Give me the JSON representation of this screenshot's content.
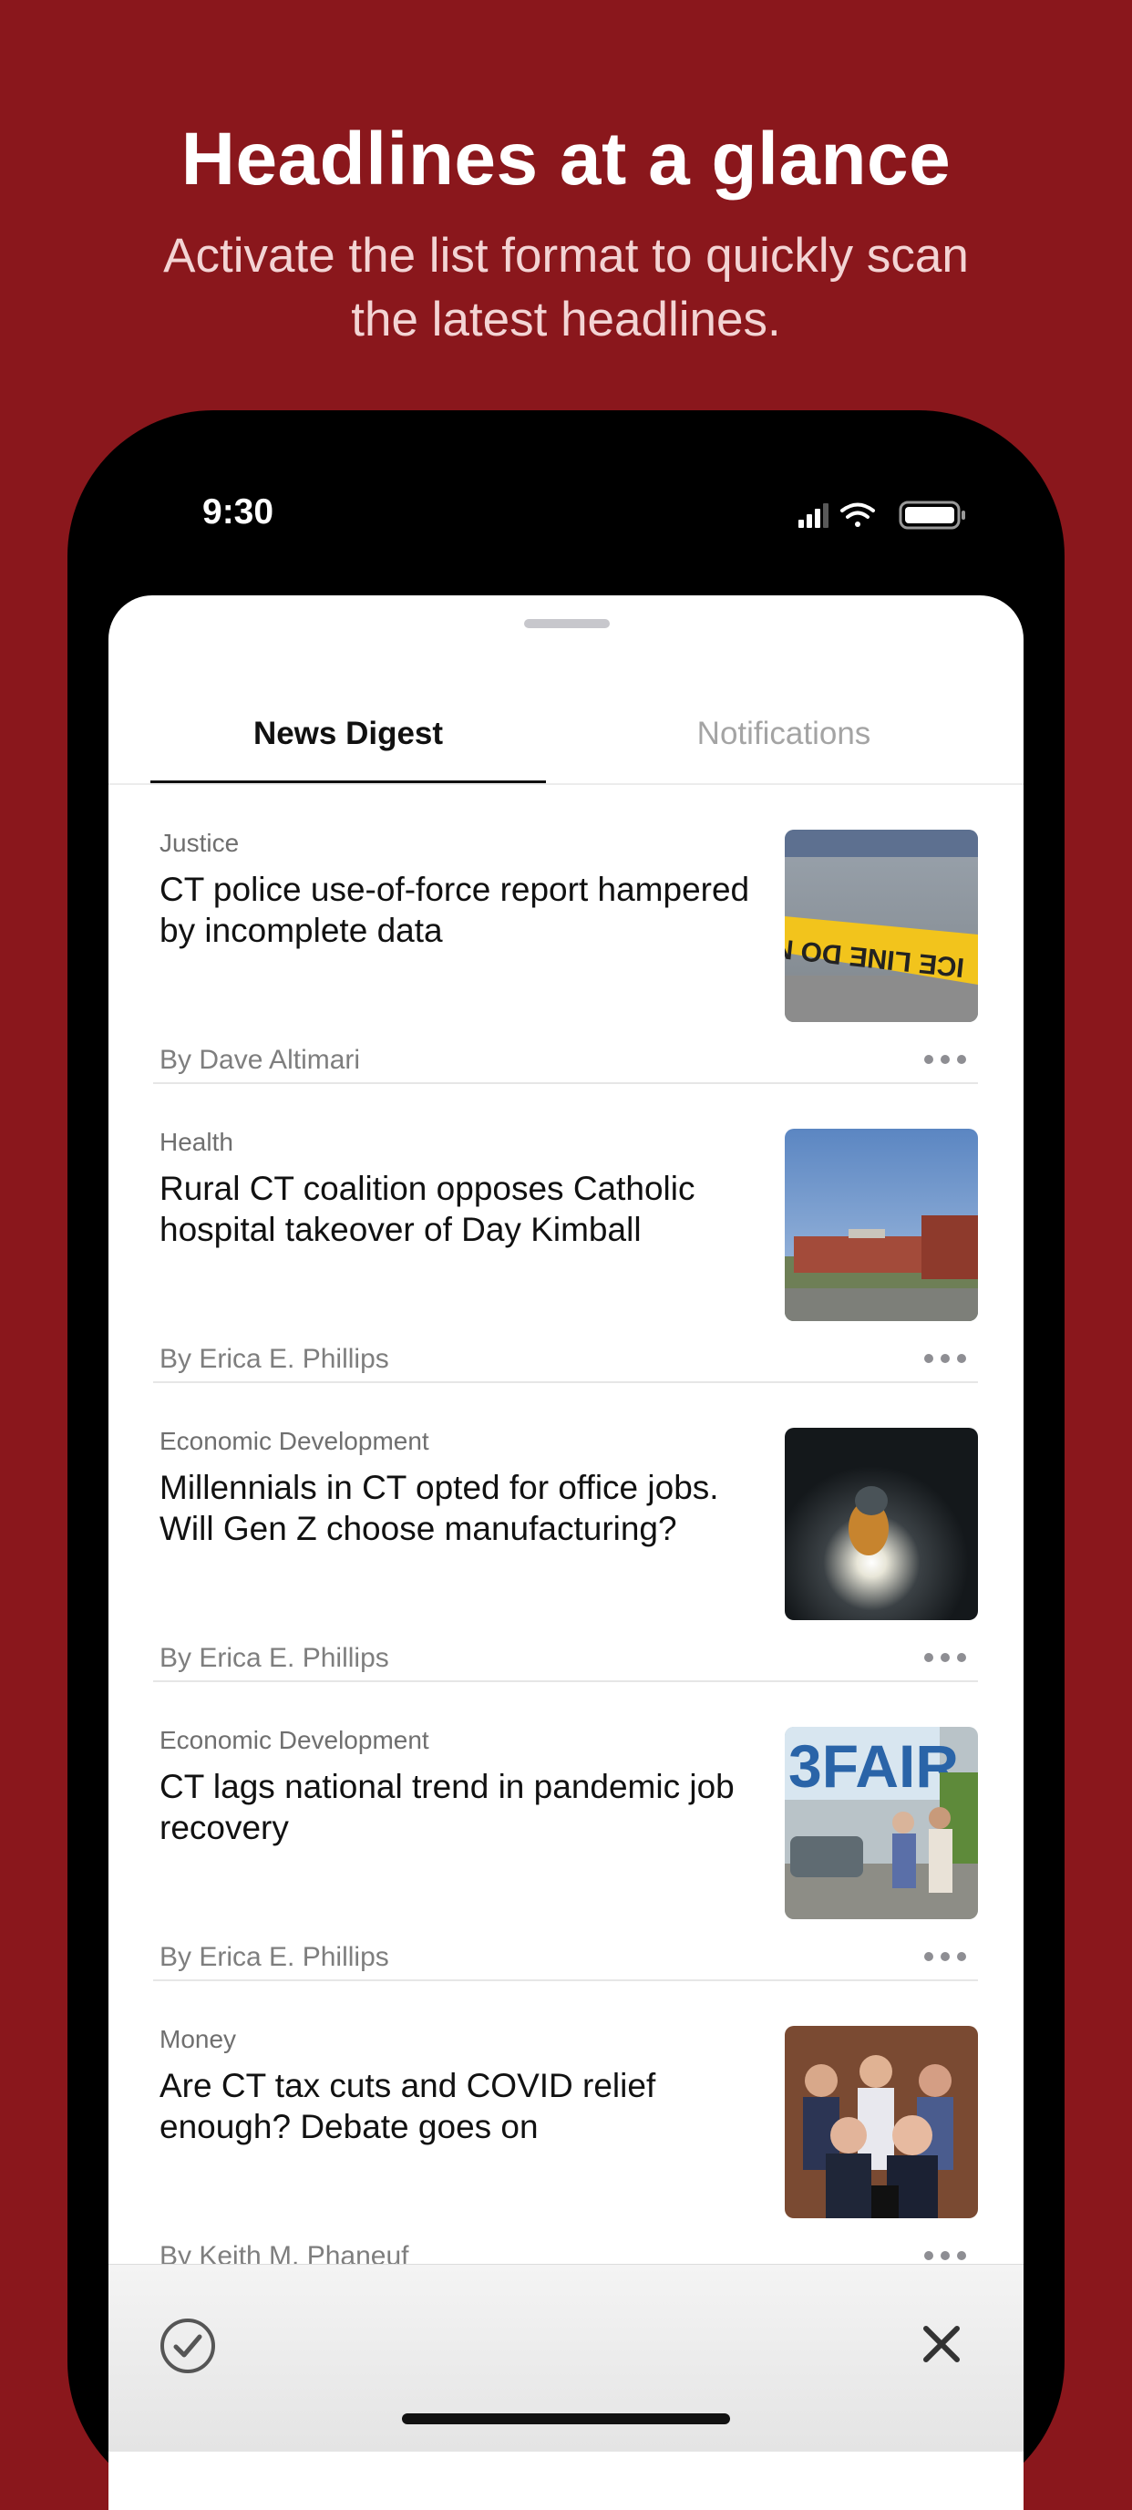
{
  "promo": {
    "title": "Headlines at a glance",
    "subtitle": "Activate the list format to quickly scan the latest headlines."
  },
  "status_bar": {
    "time": "9:30",
    "icons": [
      "cellular-signal-icon",
      "wifi-icon",
      "battery-icon"
    ]
  },
  "tabs": [
    {
      "label": "News Digest",
      "active": true
    },
    {
      "label": "Notifications",
      "active": false
    }
  ],
  "articles": [
    {
      "category": "Justice",
      "title": "CT police use-of-force report hampered by incomplete data",
      "byline": "By Dave Altimari",
      "thumbnail": "police-tape-photo"
    },
    {
      "category": "Health",
      "title": "Rural CT coalition opposes Catholic hospital takeover of Day Kimball",
      "byline": "By Erica E. Phillips",
      "thumbnail": "hospital-building-photo"
    },
    {
      "category": "Economic Development",
      "title": "Millennials in CT opted for office jobs. Will Gen Z choose manufacturing?",
      "byline": "By Erica E. Phillips",
      "thumbnail": "welder-photo"
    },
    {
      "category": "Economic Development",
      "title": "CT lags national trend in pandemic job recovery",
      "byline": "By Erica E. Phillips",
      "thumbnail": "job-fair-photo"
    },
    {
      "category": "Money",
      "title": "Are CT tax cuts and COVID relief enough? Debate goes on",
      "byline": "By Keith M. Phaneuf",
      "thumbnail": "press-conference-photo"
    }
  ],
  "bottom_bar": {
    "icons": [
      "checkmark-circle-icon",
      "close-icon"
    ]
  },
  "colors": {
    "brand_background": "#8a171c",
    "tab_active": "#111111",
    "tab_inactive": "#a4a4a4"
  }
}
